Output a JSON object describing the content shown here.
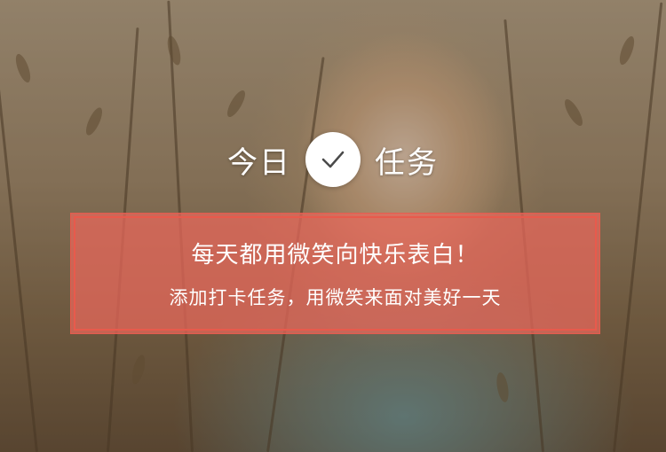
{
  "hero": {
    "title_left": "今日",
    "title_right": "任务",
    "check_icon": "checkmark-icon"
  },
  "banner": {
    "title": "每天都用微笑向快乐表白！",
    "subtitle": "添加打卡任务，用微笑来面对美好一天"
  },
  "colors": {
    "banner_fill": "#ec685c",
    "banner_border": "#e85a4c",
    "text": "#ffffff"
  }
}
